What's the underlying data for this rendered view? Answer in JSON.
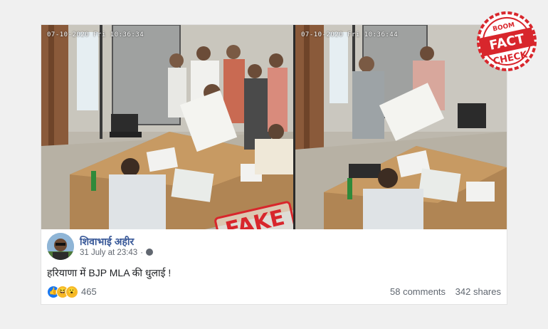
{
  "video": {
    "left_timestamp": "07-10-2020  Fri  10:36:34",
    "right_timestamp": "07-10-2020  Fri  10:36:44"
  },
  "stamp": {
    "label": "FAKE"
  },
  "badge": {
    "top": "BOOM",
    "line1": "FACT",
    "line2": "CHECK"
  },
  "post": {
    "author": "शिवाभाई अहीर",
    "date": "31 July at 23:43",
    "text": "हरियाणा में BJP MLA की धुलाई !",
    "reaction_count": "465",
    "comments": "58 comments",
    "shares": "342 shares"
  },
  "colors": {
    "stamp_red": "#d8262c",
    "author_blue": "#385898",
    "like_blue": "#1877f2"
  },
  "icons": [
    "globe-icon",
    "like-reaction-icon",
    "haha-reaction-icon",
    "wow-reaction-icon"
  ]
}
